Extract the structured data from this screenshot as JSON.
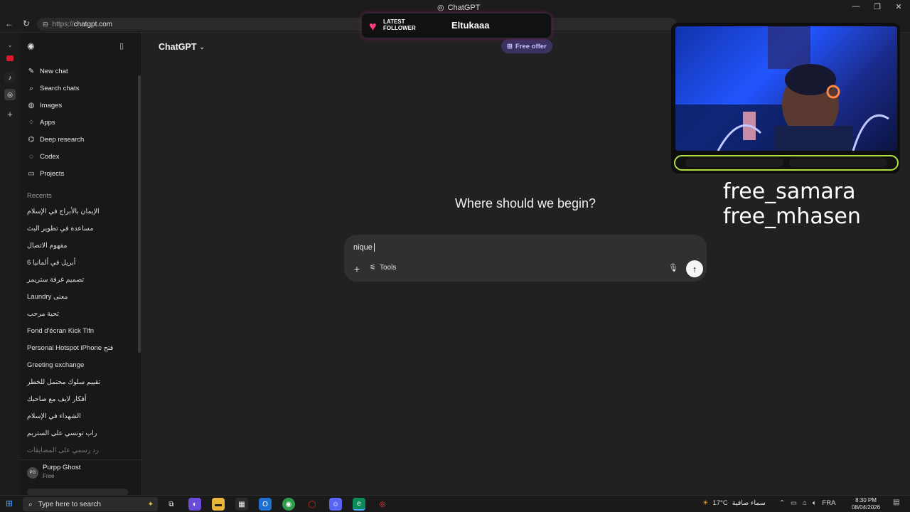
{
  "browser": {
    "tab_title": "ChatGPT",
    "url_scheme": "https://",
    "url_host": "chatgpt.com"
  },
  "sidebar": {
    "nav": [
      {
        "label": "New chat",
        "icon": "edit-icon"
      },
      {
        "label": "Search chats",
        "icon": "search-icon"
      },
      {
        "label": "Images",
        "icon": "images-icon"
      },
      {
        "label": "Apps",
        "icon": "apps-icon"
      },
      {
        "label": "Deep research",
        "icon": "deep-research-icon"
      },
      {
        "label": "Codex",
        "icon": "codex-icon"
      },
      {
        "label": "Projects",
        "icon": "folder-icon"
      }
    ],
    "recents_label": "Recents",
    "recents": [
      "الإيمان بالأبراج في الإسلام",
      "مساعدة في تطوير البث",
      "مفهوم الاتصال",
      "6 أبريل في ألمانيا",
      "تصميم غرفة ستريمر",
      "Laundry معنى",
      "تحية مرحب",
      "Fond d'écran Kick Tlfn",
      "Personal Hotspot iPhone فتح",
      "Greeting exchange",
      "تقييم سلوك محتمل للخطر",
      "أفكار لايف مع صاحبك",
      "الشهداء في الإسلام",
      "راب تونسي على الستريم",
      "رد رسمي على المضايقات"
    ],
    "user": {
      "initials": "PG",
      "name": "Purpp Ghost",
      "plan": "Free"
    }
  },
  "main": {
    "model_label": "ChatGPT",
    "free_offer": "Free offer",
    "headline": "Where should we begin?",
    "composer_text": "nique",
    "tools_label": "Tools"
  },
  "overlay": {
    "follower_label_1": "LATEST",
    "follower_label_2": "FOLLOWER",
    "follower_name": "Eltukaaa",
    "line1": "free_samara",
    "line2": "free_mhasen"
  },
  "taskbar": {
    "search_placeholder": "Type here to search",
    "temperature": "17°C",
    "weather_text": "سماء صافية",
    "language": "FRA",
    "time": "8:30 PM",
    "date": "08/04/2026"
  }
}
